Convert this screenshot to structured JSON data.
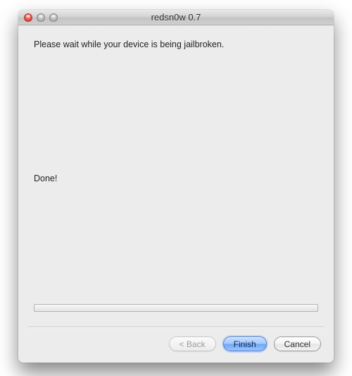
{
  "window": {
    "title": "redsn0w 0.7"
  },
  "content": {
    "instruction": "Please wait while your device is being jailbroken.",
    "status": "Done!"
  },
  "buttons": {
    "back": "< Back",
    "finish": "Finish",
    "cancel": "Cancel"
  }
}
